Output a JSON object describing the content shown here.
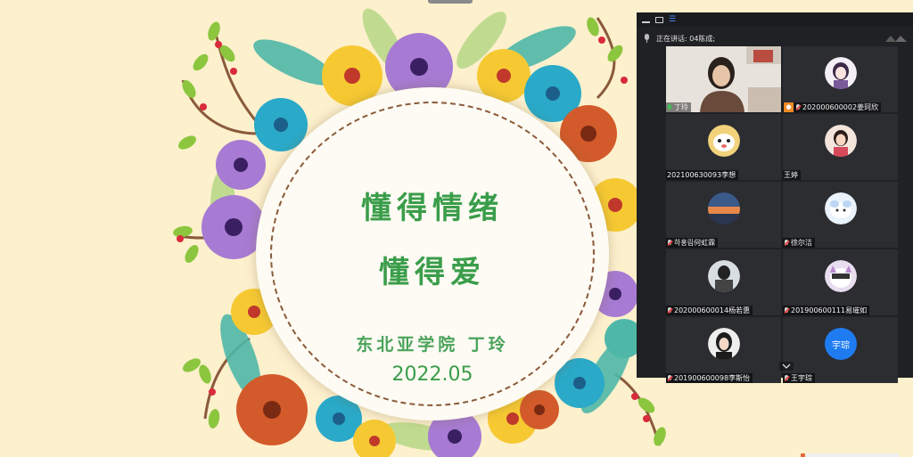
{
  "slide": {
    "title_line1": "懂得情绪",
    "title_line2": "懂得爱",
    "author": "东北亚学院 丁玲",
    "date": "2022.05"
  },
  "meeting_panel": {
    "speaking_label": "正在讲话: 04陈成;",
    "scroll_up_icon": "chevron-up-icon",
    "scroll_down_icon": "chevron-down-icon",
    "participants": [
      {
        "name": "丁玲",
        "mic": "on",
        "kind": "video"
      },
      {
        "name": "202000600002姜珂欣",
        "mic": "muted",
        "host": true,
        "kind": "avatar"
      },
      {
        "name": "202100630093李想",
        "mic": "none",
        "kind": "avatar"
      },
      {
        "name": "王婷",
        "mic": "none",
        "kind": "avatar"
      },
      {
        "name": "하홍림何虹霖",
        "mic": "muted",
        "kind": "avatar"
      },
      {
        "name": "徐尔洁",
        "mic": "muted",
        "kind": "avatar"
      },
      {
        "name": "202000600014杨若惠",
        "mic": "muted",
        "kind": "avatar"
      },
      {
        "name": "201900600111易璀如",
        "mic": "muted",
        "kind": "avatar"
      },
      {
        "name": "201900600098李斯怡",
        "mic": "muted",
        "kind": "avatar"
      },
      {
        "name": "王宇琮",
        "mic": "muted",
        "kind": "text",
        "avatar_text": "宇琮"
      }
    ]
  },
  "colors": {
    "slide_bg": "#fdf0cd",
    "title_green": "#3a9d4a",
    "panel_bg": "#202124",
    "tile_bg": "#2c2d31",
    "accent_blue": "#1e7cf0"
  }
}
